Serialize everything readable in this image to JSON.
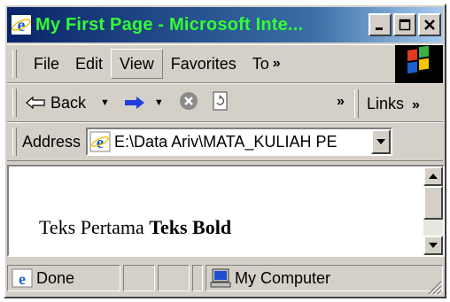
{
  "window": {
    "title": "My First Page - Microsoft Inte...",
    "accent_title_text_color": "#33ff33",
    "titlebar_gradient_start": "#0a246a"
  },
  "menubar": {
    "items": [
      "File",
      "Edit",
      "View",
      "Favorites",
      "To"
    ],
    "active_item": "View",
    "overflow": "»"
  },
  "toolbar": {
    "back_label": "Back",
    "overflow": "»",
    "links_label": "Links",
    "links_overflow": "»"
  },
  "address": {
    "label": "Address",
    "value": "E:\\Data Ariv\\MATA_KULIAH PE"
  },
  "content": {
    "normal_text": "Teks Pertama",
    "bold_text": "Teks Bold"
  },
  "status": {
    "text": "Done",
    "zone": "My Computer"
  },
  "icons": {
    "ie": "ie-icon",
    "minimize": "minimize-icon",
    "maximize": "maximize-icon",
    "close": "close-icon",
    "back": "back-arrow-icon",
    "forward": "forward-arrow-icon",
    "stop": "stop-icon",
    "refresh": "refresh-icon",
    "computer": "computer-icon"
  }
}
